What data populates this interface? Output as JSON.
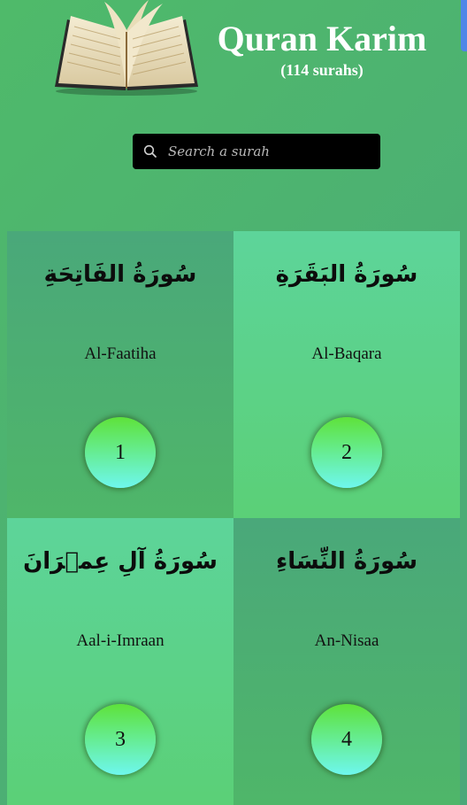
{
  "header": {
    "title": "Quran Karim",
    "subtitle": "(114 surahs)",
    "logo_icon": "open-book-icon"
  },
  "search": {
    "placeholder": "Search a surah",
    "value": "",
    "icon": "search-icon"
  },
  "colors": {
    "background": "#4fba6a",
    "card_dark": "#4aa87a",
    "card_light": "#5dd49a",
    "badge_top": "#5ee23a",
    "badge_bottom": "#6ef7ee",
    "search_bg": "#000000"
  },
  "surahs": [
    {
      "arabic": "سُورَةُ الفَاتِحَةِ",
      "english": "Al-Faatiha",
      "number": "1"
    },
    {
      "arabic": "سُورَةُ البَقَرَةِ",
      "english": "Al-Baqara",
      "number": "2"
    },
    {
      "arabic": "سُورَةُ آلِ عِمۡرَانَ",
      "english": "Aal-i-Imraan",
      "number": "3"
    },
    {
      "arabic": "سُورَةُ النِّسَاءِ",
      "english": "An-Nisaa",
      "number": "4"
    }
  ]
}
